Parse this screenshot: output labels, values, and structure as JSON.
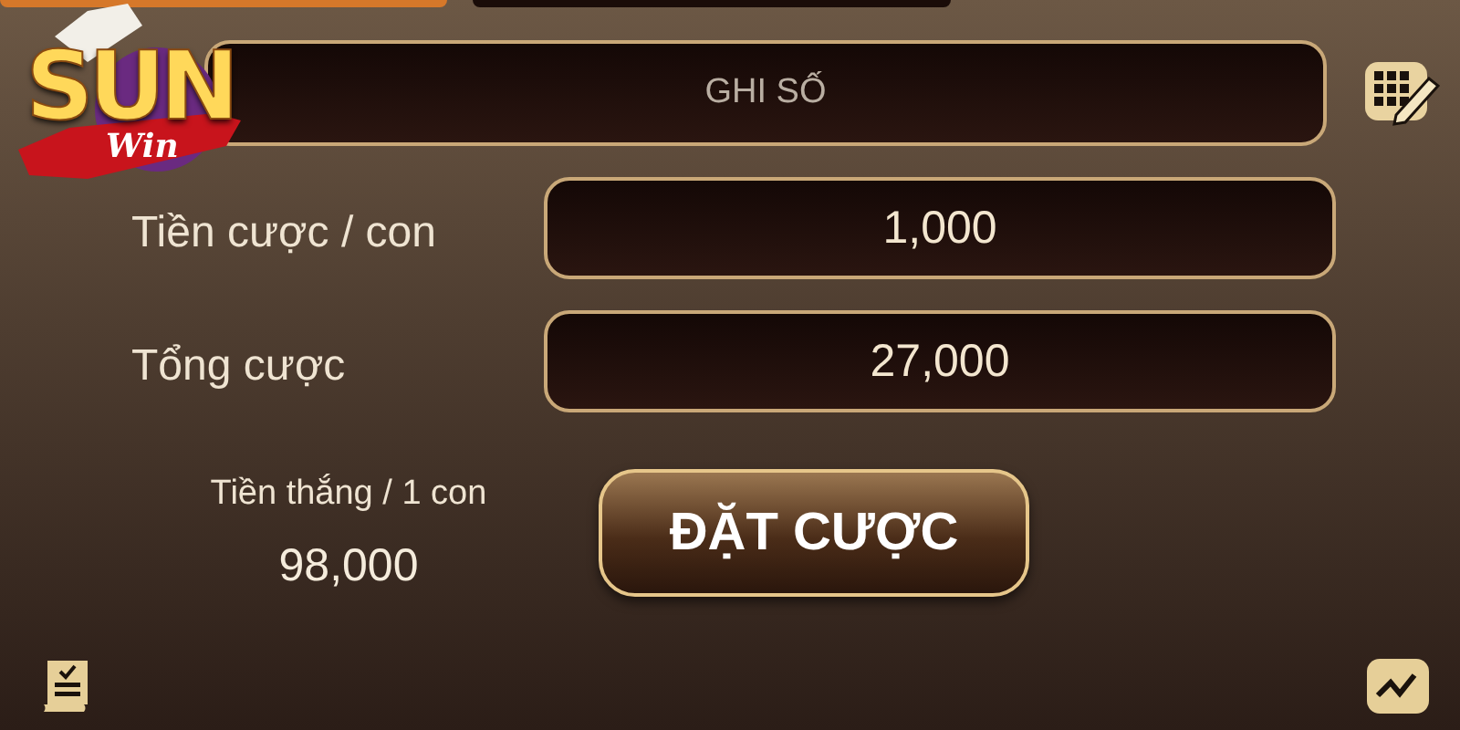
{
  "logo": {
    "title": "SUN",
    "subtitle": "Win"
  },
  "note_field": {
    "placeholder": "GHI SỐ"
  },
  "bet_per_number": {
    "label": "Tiền cược / con",
    "value": "1,000"
  },
  "total_bet": {
    "label": "Tổng cược",
    "value": "27,000"
  },
  "win_per_number": {
    "label": "Tiền thắng / 1 con",
    "value": "98,000"
  },
  "place_bet_button": {
    "label": "ĐẶT CƯỢC"
  }
}
